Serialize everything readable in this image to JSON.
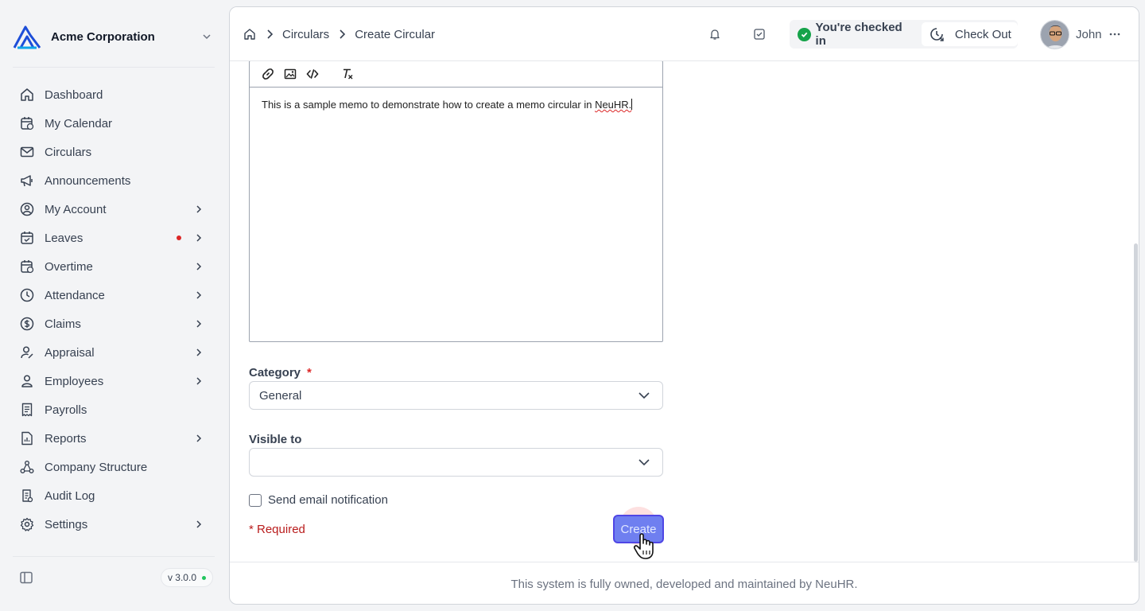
{
  "sidebar": {
    "company": "Acme Corporation",
    "items": [
      {
        "label": "Dashboard"
      },
      {
        "label": "My Calendar"
      },
      {
        "label": "Circulars"
      },
      {
        "label": "Announcements"
      },
      {
        "label": "My Account"
      },
      {
        "label": "Leaves"
      },
      {
        "label": "Overtime"
      },
      {
        "label": "Attendance"
      },
      {
        "label": "Claims"
      },
      {
        "label": "Appraisal"
      },
      {
        "label": "Employees"
      },
      {
        "label": "Payrolls"
      },
      {
        "label": "Reports"
      },
      {
        "label": "Company Structure"
      },
      {
        "label": "Audit Log"
      },
      {
        "label": "Settings"
      }
    ],
    "version": "v 3.0.0"
  },
  "header": {
    "breadcrumbs": [
      "Circulars",
      "Create Circular"
    ],
    "checkin_status": "You're checked in",
    "checkout_label": "Check Out",
    "user_name": "John"
  },
  "editor": {
    "text_before": "This is a sample memo to demonstrate how to create a memo circular in ",
    "text_misspelled": "NeuHR."
  },
  "form": {
    "category_label": "Category",
    "required_star": "*",
    "category_value": "General",
    "visible_label": "Visible to",
    "visible_value": "",
    "email_notification_label": "Send email notification",
    "required_note": "* Required",
    "create_label": "Create"
  },
  "footer": {
    "text": "This system is fully owned, developed and maintained by NeuHR."
  },
  "colors": {
    "accent": "#4f46e5",
    "success": "#16a34a",
    "danger": "#dc2626"
  }
}
